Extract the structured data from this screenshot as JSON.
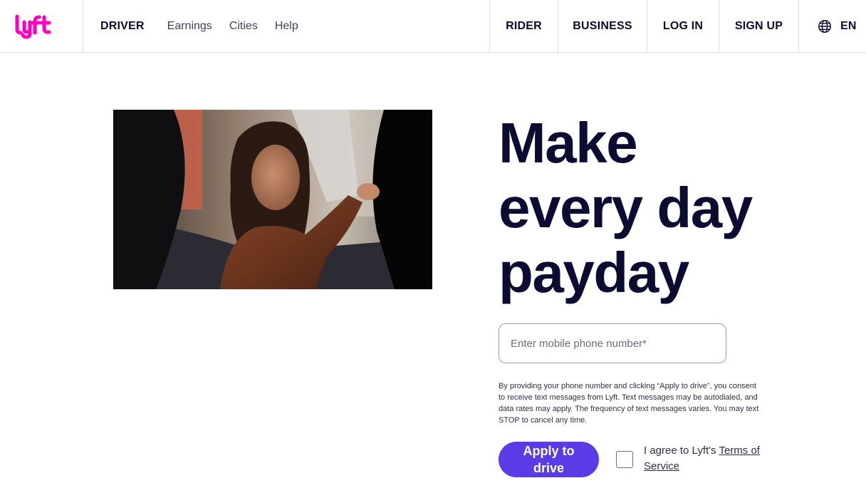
{
  "brand": {
    "logo_text": "lyft",
    "accent": "#ff00bf",
    "button_color": "#5a3be6",
    "text_color": "#0c0b31"
  },
  "header": {
    "driver_label": "DRIVER",
    "links": [
      {
        "label": "Earnings"
      },
      {
        "label": "Cities"
      },
      {
        "label": "Help"
      }
    ],
    "right": {
      "rider": "RIDER",
      "business": "BUSINESS",
      "login": "LOG IN",
      "signup": "SIGN UP",
      "language": "EN"
    },
    "language_icon": "globe-icon"
  },
  "hero": {
    "headline_lines": [
      "Make",
      "every day",
      "payday"
    ],
    "phone_placeholder": "Enter mobile phone number*",
    "phone_value": "",
    "disclaimer": "By providing your phone number and clicking “Apply to drive”, you consent to receive text messages from Lyft. Text messages may be autodialed, and data rates may apply. The frequency of text messages varies. You may text STOP to cancel any time.",
    "apply_label": "Apply to drive",
    "agree_prefix": "I agree to Lyft's ",
    "terms_link": "Terms of Service",
    "agree_checked": false
  }
}
